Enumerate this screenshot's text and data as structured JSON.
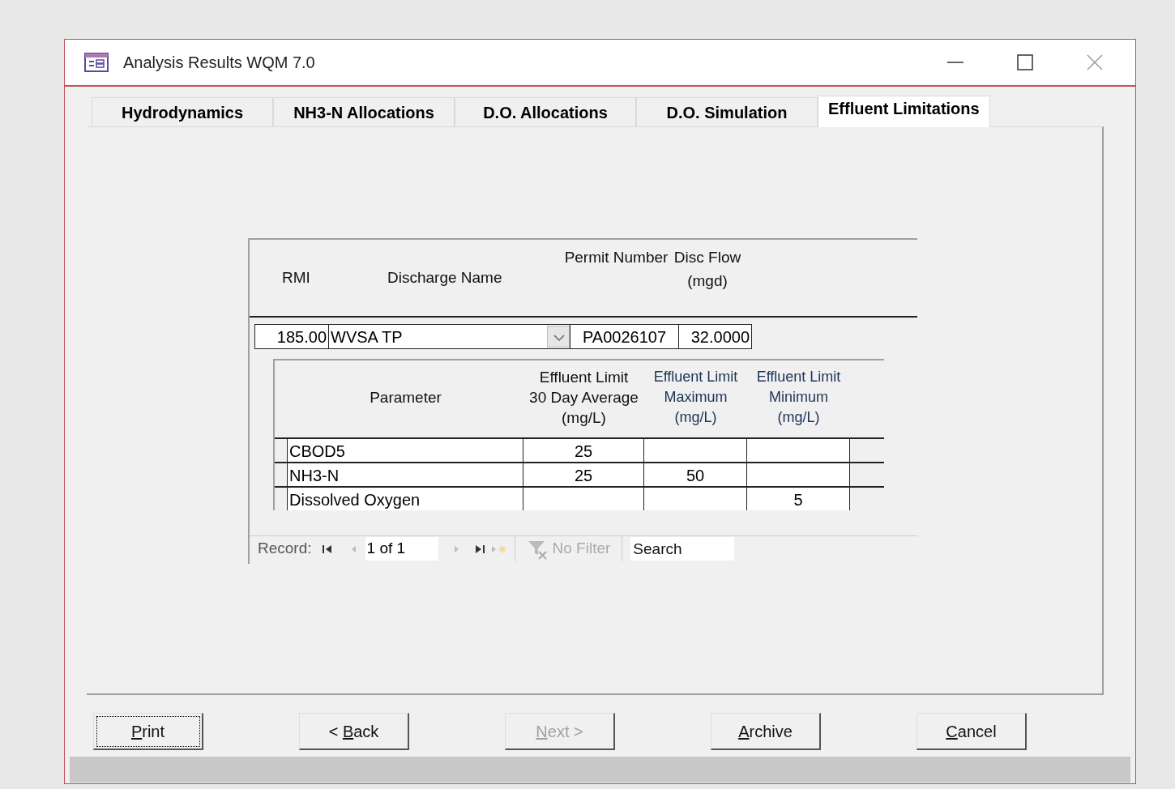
{
  "window": {
    "title": "Analysis Results WQM 7.0"
  },
  "tabs": [
    {
      "label": "Hydrodynamics",
      "selected": false
    },
    {
      "label": "NH3-N Allocations",
      "selected": false
    },
    {
      "label": "D.O. Allocations",
      "selected": false
    },
    {
      "label": "D.O. Simulation",
      "selected": false
    },
    {
      "label": "Effluent Limitations",
      "selected": true
    }
  ],
  "discharge_form": {
    "headers": [
      {
        "lines": [
          "RMI"
        ]
      },
      {
        "lines": [
          "Discharge Name"
        ]
      },
      {
        "lines": [
          "Permit Number"
        ]
      },
      {
        "lines": [
          "Disc Flow",
          "(mgd)"
        ]
      }
    ],
    "record": {
      "rmi": "185.00",
      "discharge_name": "WVSA TP",
      "permit_number": "PA0026107",
      "disc_flow": "32.0000"
    },
    "limits_table": {
      "columns": [
        {
          "lines": [
            "Parameter"
          ],
          "tinted": false
        },
        {
          "lines": [
            "Effluent Limit",
            "30 Day Average",
            "(mg/L)"
          ],
          "tinted": false
        },
        {
          "lines": [
            "Effluent Limit",
            "Maximum",
            "(mg/L)"
          ],
          "tinted": true
        },
        {
          "lines": [
            "Effluent Limit",
            "Minimum",
            "(mg/L)"
          ],
          "tinted": true
        }
      ],
      "rows": [
        {
          "cells": [
            "CBOD5",
            "25",
            "",
            ""
          ]
        },
        {
          "cells": [
            "NH3-N",
            "25",
            "50",
            ""
          ]
        },
        {
          "cells": [
            "Dissolved Oxygen",
            "",
            "",
            "5"
          ]
        }
      ]
    },
    "navigation": {
      "label": "Record:",
      "position": "1 of 1",
      "filter": "No Filter",
      "search_placeholder": "Search"
    }
  },
  "buttons": [
    {
      "key": "P",
      "after": "rint",
      "disabled": false,
      "focused": true
    },
    {
      "before": "< ",
      "key": "B",
      "after": "ack",
      "disabled": false,
      "focused": false
    },
    {
      "key": "N",
      "after": "ext >",
      "disabled": true,
      "focused": false
    },
    {
      "key": "A",
      "after": "rchive",
      "disabled": false,
      "focused": false
    },
    {
      "key": "C",
      "after": "ancel",
      "disabled": false,
      "focused": false
    }
  ]
}
